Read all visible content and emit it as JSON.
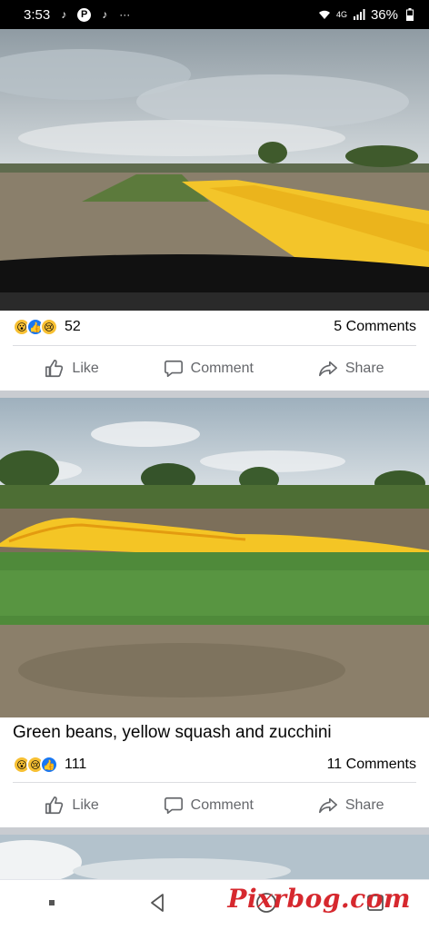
{
  "status_bar": {
    "time": "3:53",
    "network": "4G",
    "battery": "36%"
  },
  "post1": {
    "reaction_count": "52",
    "comments": "5 Comments"
  },
  "post2": {
    "caption": "Green beans, yellow squash and zucchini",
    "reaction_count": "111",
    "comments": "11 Comments"
  },
  "actions": {
    "like": "Like",
    "comment": "Comment",
    "share": "Share"
  },
  "watermark": "Pixrbog.com",
  "colors": {
    "facebook_blue": "#1877f2",
    "action_gray": "#65676b",
    "watermark_red": "#d6282e"
  }
}
